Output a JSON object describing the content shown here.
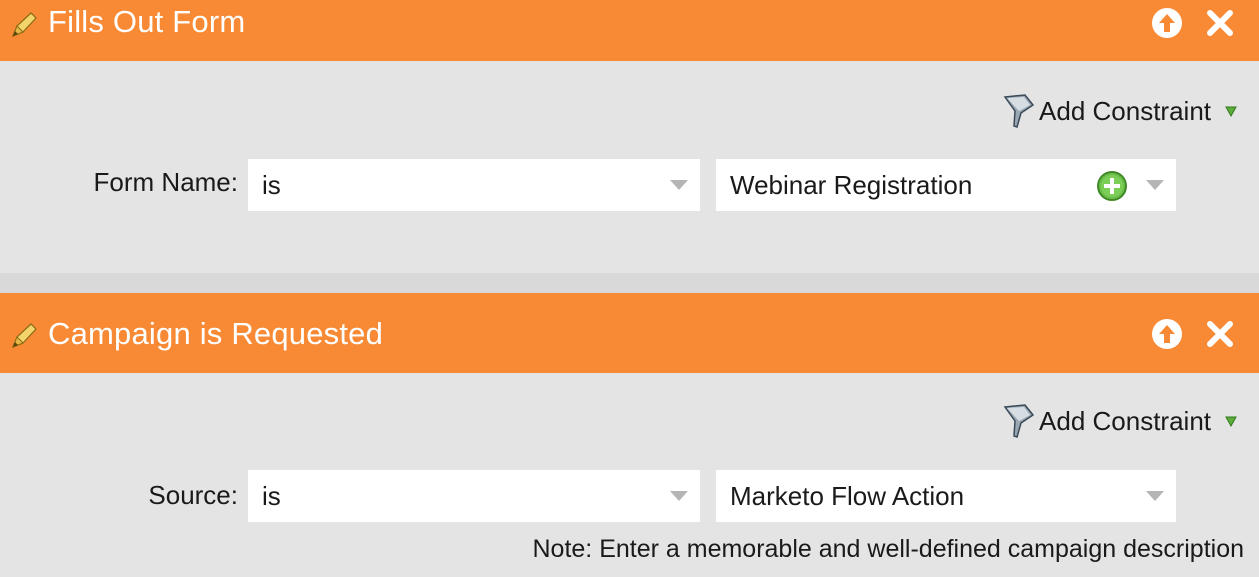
{
  "triggers": [
    {
      "title": "Fills Out Form",
      "add_constraint": "Add Constraint",
      "row_label": "Form Name:",
      "operator": "is",
      "value": "Webinar Registration"
    },
    {
      "title": "Campaign is Requested",
      "add_constraint": "Add Constraint",
      "row_label": "Source:",
      "operator": "is",
      "value": "Marketo Flow Action",
      "note": "Note: Enter a memorable and well-defined campaign description"
    }
  ],
  "colors": {
    "header": "#f98a35",
    "panel": "#e4e4e4",
    "add_green": "#5dac3c"
  },
  "icons": {
    "trigger": "pencil-trigger-icon",
    "move_up": "arrow-up-circle-icon",
    "close": "close-x-icon",
    "constraint": "funnel-icon",
    "dropdown": "triangle-down-icon",
    "add": "plus-circle-icon"
  }
}
